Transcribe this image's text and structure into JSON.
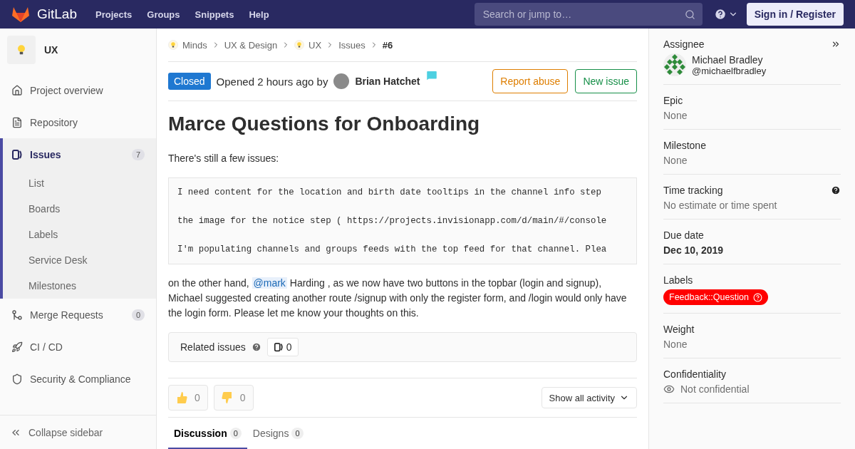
{
  "header": {
    "logo": "GitLab",
    "nav": [
      "Projects",
      "Groups",
      "Snippets",
      "Help"
    ],
    "search": {
      "placeholder": "Search or jump to…"
    },
    "sign_in": "Sign in / Register"
  },
  "sidebar": {
    "project": "UX",
    "items": [
      {
        "label": "Project overview",
        "selected": false
      },
      {
        "label": "Repository",
        "selected": false
      },
      {
        "label": "Issues",
        "count": "7",
        "selected": true,
        "children": [
          {
            "label": "List"
          },
          {
            "label": "Boards"
          },
          {
            "label": "Labels"
          },
          {
            "label": "Service Desk"
          },
          {
            "label": "Milestones"
          }
        ]
      },
      {
        "label": "Merge Requests",
        "count": "0",
        "selected": false
      },
      {
        "label": "CI / CD",
        "selected": false
      },
      {
        "label": "Security & Compliance",
        "selected": false
      }
    ],
    "collapse": "Collapse sidebar"
  },
  "breadcrumbs": [
    {
      "label": "Minds",
      "avatar": true,
      "current": false
    },
    {
      "label": "UX & Design",
      "avatar": false,
      "current": false
    },
    {
      "label": "UX",
      "avatar": true,
      "current": false
    },
    {
      "label": "Issues",
      "avatar": false,
      "current": false
    },
    {
      "label": "#6",
      "avatar": false,
      "current": true
    }
  ],
  "issue": {
    "status": "Closed",
    "opened": "Opened 2 hours ago by",
    "author": "Brian Hatchet",
    "buttons": [
      {
        "label": "Report abuse",
        "kind": "warning"
      },
      {
        "label": "New issue",
        "kind": "success"
      }
    ],
    "title": "Marce Questions for Onboarding",
    "intro": "There's still a few issues:",
    "code": [
      "I need content for the location and birth date tooltips in the channel info step",
      "the image for the notice step ( https://projects.invisionapp.com/d/main/#/console",
      "I'm populating channels and groups feeds with the top feed for that channel. Plea"
    ],
    "closing": {
      "before": "on the other hand, ",
      "mention": "@mark",
      "after": " Harding , as we now have two buttons in the topbar (login and signup), Michael suggested creating another route /signup with only the register form, and /login would only have the login form. Please let me know your thoughts on this."
    },
    "related": {
      "label": "Related issues",
      "count": "0"
    },
    "awards": [
      {
        "kind": "thumbsup",
        "count": "0"
      },
      {
        "kind": "thumbsdown",
        "count": "0"
      }
    ],
    "activity": "Show all activity",
    "tabs": [
      {
        "label": "Discussion",
        "count": "0",
        "selected": true
      },
      {
        "label": "Designs",
        "count": "0",
        "selected": false
      }
    ]
  },
  "right_sidebar": [
    {
      "kind": "user",
      "title": "Assignee",
      "name": "Michael Bradley",
      "username": "@michaelfbradley"
    },
    {
      "kind": "text",
      "title": "Epic",
      "value": "None"
    },
    {
      "kind": "text",
      "title": "Milestone",
      "value": "None"
    },
    {
      "kind": "text",
      "title": "Time tracking",
      "value": "No estimate or time spent",
      "help": true
    },
    {
      "kind": "bold",
      "title": "Due date",
      "value": "Dec 10, 2019"
    },
    {
      "kind": "label",
      "title": "Labels",
      "value": "Feedback::Question",
      "color": "#ff0000"
    },
    {
      "kind": "text",
      "title": "Weight",
      "value": "None"
    },
    {
      "kind": "confidential",
      "title": "Confidentiality",
      "value": "Not confidential"
    }
  ]
}
